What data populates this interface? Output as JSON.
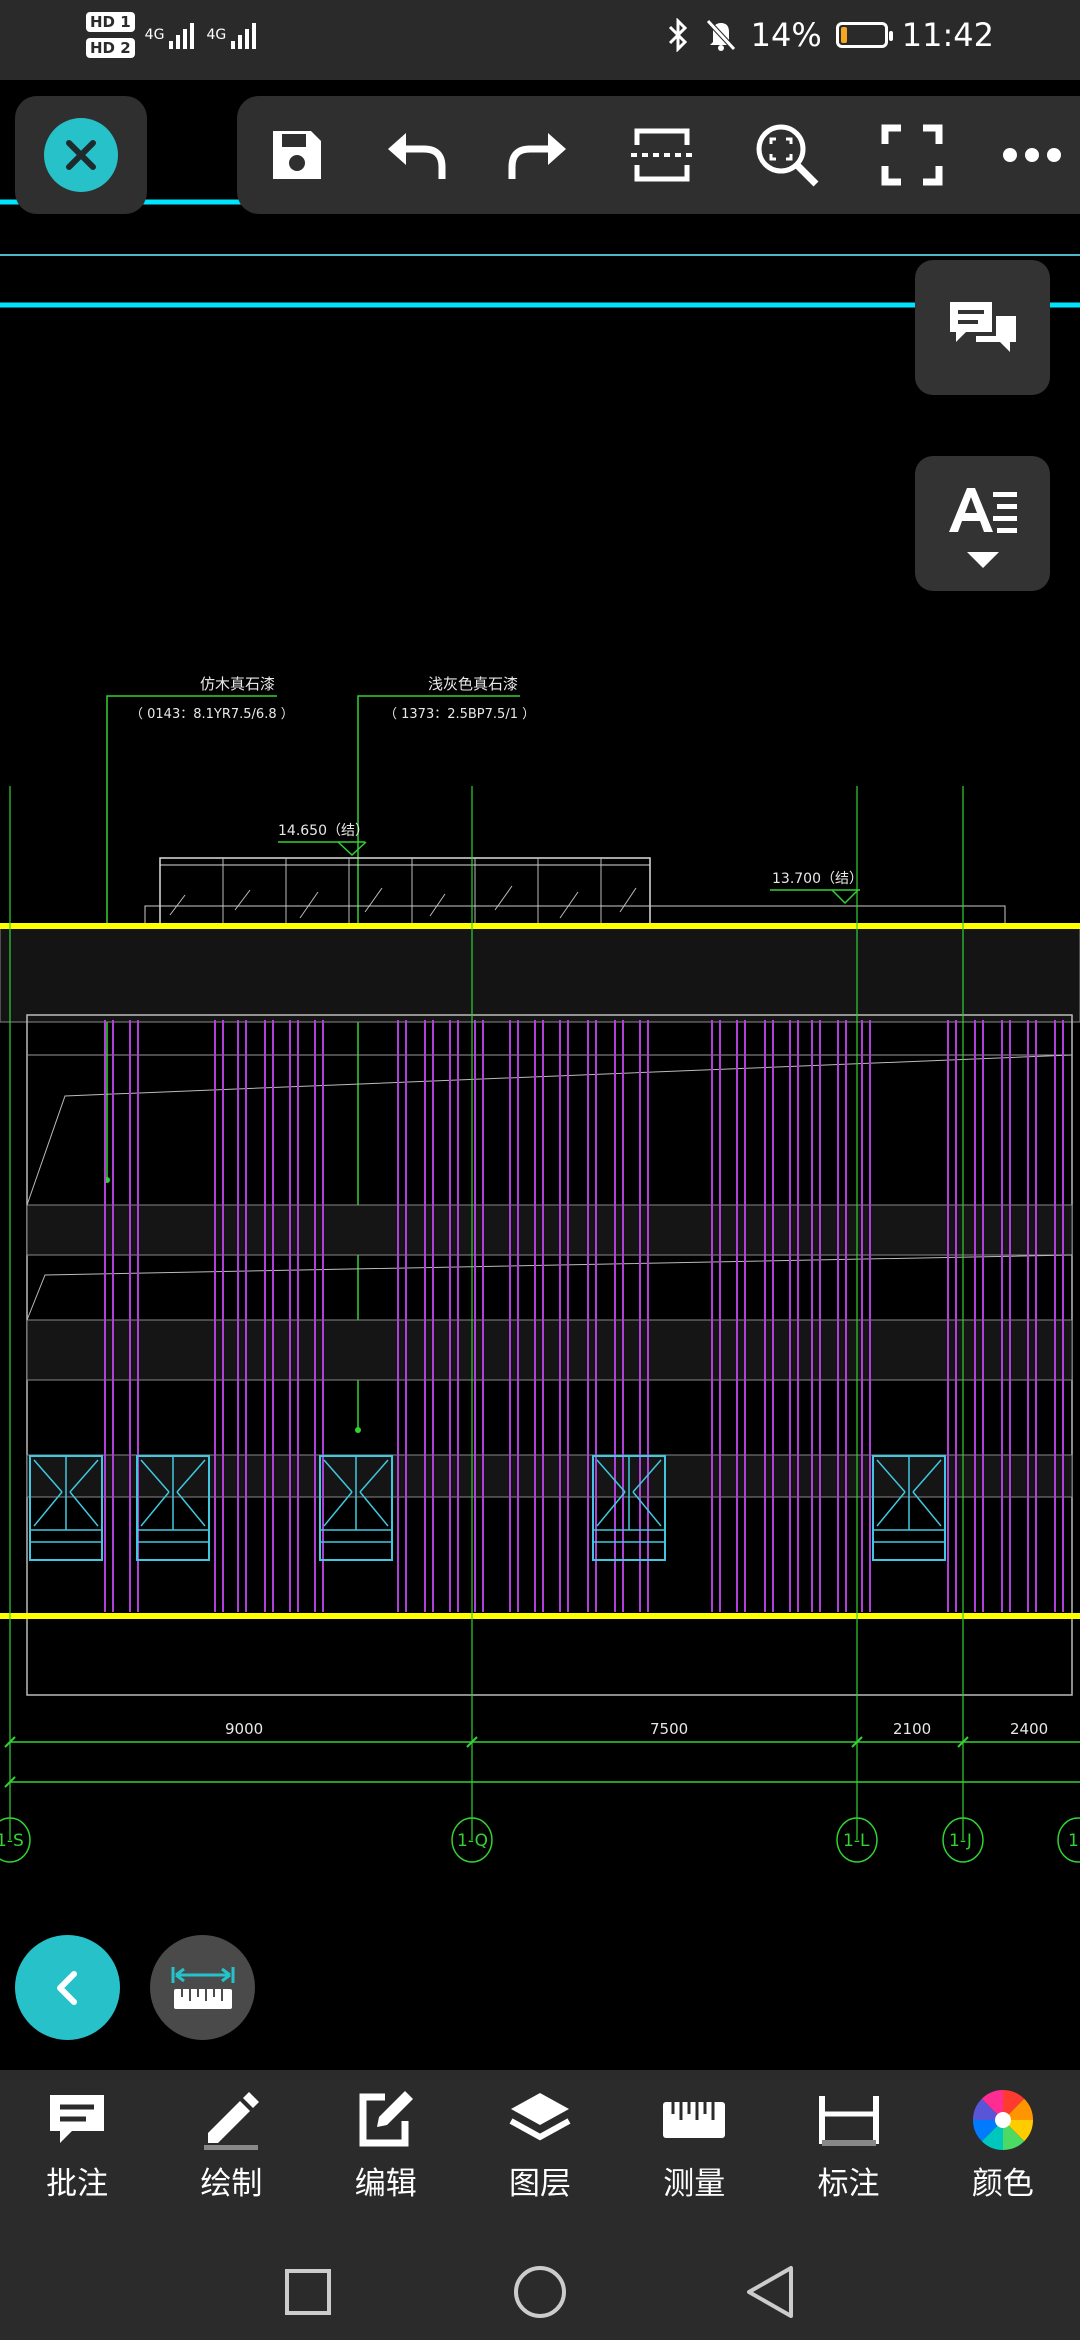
{
  "status_bar": {
    "sim1_badge": "HD 1",
    "sim2_badge": "HD 2",
    "sim1_net": "4G",
    "sim2_net": "4G",
    "battery_percent": "14%",
    "battery_level": 0.14,
    "time": "11:42",
    "icons": [
      "bluetooth-icon",
      "mute-icon",
      "battery-icon"
    ]
  },
  "toolbar": {
    "close": "close-icon",
    "buttons": [
      "save-icon",
      "undo-icon",
      "redo-icon",
      "crop-icon",
      "zoom-extents-icon",
      "fullscreen-icon",
      "more-icon"
    ]
  },
  "drawing": {
    "note1_title": "仿木真石漆",
    "note1_code": "（ 0143：8.1YR7.5/6.8 ）",
    "note2_title": "浅灰色真石漆",
    "note2_code": "（ 1373：2.5BP7.5/1 ）",
    "elev_top": "14.650（结）",
    "elev_roof": "13.700（结）",
    "dims": [
      "9000",
      "7500",
      "2100",
      "2400"
    ],
    "axes": [
      "1-S",
      "1-Q",
      "1-L",
      "1-J",
      "1"
    ],
    "colors": {
      "section_line": "#ffff00",
      "cyan_line": "#00e5ff",
      "column_magenta": "#b040d8",
      "dim_green": "#32d232",
      "window_cyan": "#40c8e0"
    }
  },
  "bottom_tools": [
    {
      "label": "批注",
      "icon": "comment-icon"
    },
    {
      "label": "绘制",
      "icon": "pencil-icon"
    },
    {
      "label": "编辑",
      "icon": "edit-icon"
    },
    {
      "label": "图层",
      "icon": "layers-icon"
    },
    {
      "label": "测量",
      "icon": "ruler-icon"
    },
    {
      "label": "标注",
      "icon": "dimension-icon"
    },
    {
      "label": "颜色",
      "icon": "color-wheel-icon"
    }
  ],
  "nav": [
    "recents-icon",
    "home-icon",
    "back-icon"
  ]
}
